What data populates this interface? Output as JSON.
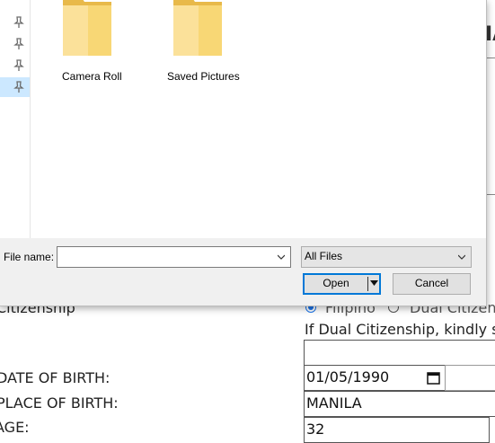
{
  "form": {
    "citizenship_label": "Citizenship",
    "citizenship_options": [
      "Filipino",
      "Dual Citizen"
    ],
    "dual_citizenship_note": "If Dual Citizenship, kindly sp",
    "dob_label": "DATE OF BIRTH:",
    "dob_value": "01/05/1990",
    "pob_label": "PLACE OF BIRTH:",
    "pob_value": "MANILA",
    "age_label": "AGE:",
    "age_value": "32",
    "header_fragment": "IA"
  },
  "dialog": {
    "folders": [
      {
        "name": "Camera Roll"
      },
      {
        "name": "Saved Pictures"
      }
    ],
    "file_name_label": "File name:",
    "file_name_value": "",
    "file_type_value": "All Files",
    "open_button": "Open",
    "cancel_button": "Cancel"
  },
  "colors": {
    "accent": "#0078d7",
    "selection": "#cce8ff",
    "folder": "#f8d775"
  }
}
